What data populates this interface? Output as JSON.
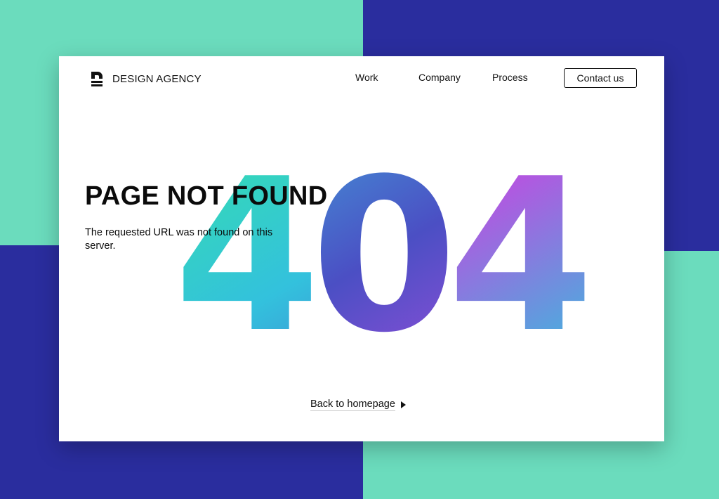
{
  "brand": {
    "name": "DESIGN AGENCY",
    "logo_icon": "agency-logo-icon"
  },
  "nav": {
    "items": [
      {
        "label": "Work"
      },
      {
        "label": "Company"
      },
      {
        "label": "Process"
      }
    ],
    "cta_label": "Contact us"
  },
  "error": {
    "code": "404",
    "title": "PAGE NOT FOUND",
    "message": "The requested URL was not found on this server."
  },
  "back_link": {
    "label": "Back to homepage",
    "icon": "triangle-right-icon"
  },
  "colors": {
    "teal": "#6bdcbd",
    "navy": "#2a2d9e",
    "purple": "#8a4fe6",
    "magenta": "#c24ae0",
    "cyan": "#33c1dd",
    "green": "#35e0ac"
  }
}
